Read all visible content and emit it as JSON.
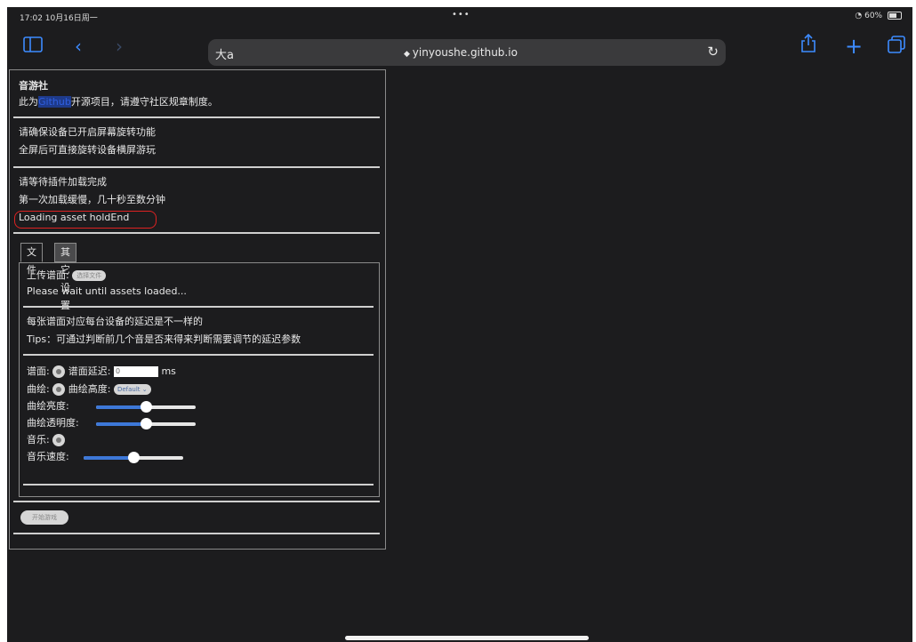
{
  "status_bar": {
    "time": "17:02 10月16日周一",
    "dots": "•••",
    "battery_text": "60%"
  },
  "toolbar": {
    "aa_label": "大a",
    "url": "yinyoushe.github.io",
    "reload_icon": "↻"
  },
  "panel": {
    "title": "音游社",
    "intro_prefix": "此为",
    "intro_link": "Github",
    "intro_suffix": "开源项目，请遵守社区规章制度。",
    "rotate_line1": "请确保设备已开启屏幕旋转功能",
    "rotate_line2": "全屏后可直接旋转设备横屏游玩",
    "loading_line1": "请等待插件加载完成",
    "loading_line2": "第一次加载缓慢，几十秒至数分钟",
    "loading_line3": "Loading asset holdEnd"
  },
  "tabs": [
    {
      "label": "文件"
    },
    {
      "label": "其它设置"
    }
  ],
  "file_tab": {
    "upload_label": "上传谱面:",
    "upload_button": "选择文件",
    "wait_text": "Please wait until assets loaded...",
    "note1": "每张谱面对应每台设备的延迟是不一样的",
    "note2": "Tips：可通过判断前几个音是否来得来判断需要调节的延迟参数",
    "chart_label": "谱面:",
    "offset_label": "谱面延迟:",
    "offset_value": "0",
    "offset_unit": "ms",
    "curve_label": "曲绘:",
    "curve_height_label": "曲绘高度:",
    "curve_height_select": "Default",
    "curve_brightness_label": "曲绘亮度:",
    "curve_opacity_label": "曲绘透明度:",
    "music_label": "音乐:",
    "music_speed_label": "音乐速度:"
  },
  "sliders": {
    "brightness": 0.5,
    "opacity": 0.5,
    "speed": 0.5
  },
  "bottom_button": "开始游戏"
}
